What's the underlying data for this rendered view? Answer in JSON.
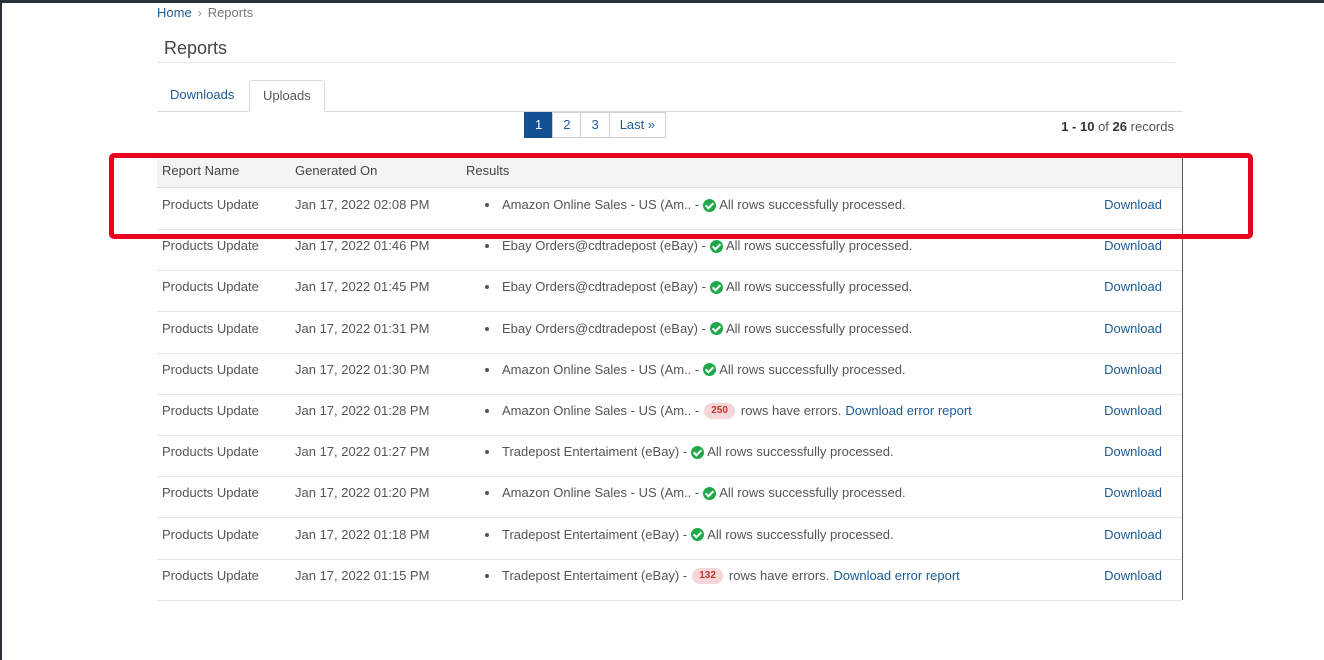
{
  "breadcrumb": {
    "home": "Home",
    "separator": "›",
    "current": "Reports"
  },
  "page": {
    "title": "Reports"
  },
  "tabs": [
    {
      "label": "Downloads"
    },
    {
      "label": "Uploads"
    }
  ],
  "pagination": {
    "pages": [
      "1",
      "2",
      "3"
    ],
    "last": "Last »",
    "active": "1"
  },
  "records": {
    "range": "1 - 10",
    "of": "of",
    "total": "26",
    "suffix": "records"
  },
  "table": {
    "headers": {
      "name": "Report Name",
      "date": "Generated On",
      "results": "Results"
    },
    "rows": [
      {
        "name": "Products Update",
        "date": "Jan 17, 2022 02:08 PM",
        "source": "Amazon Online Sales - US (Am.. -",
        "status": "ok",
        "message": "All rows successfully processed.",
        "download": "Download"
      },
      {
        "name": "Products Update",
        "date": "Jan 17, 2022 01:46 PM",
        "source": "Ebay Orders@cdtradepost (eBay) -",
        "status": "ok",
        "message": "All rows successfully processed.",
        "download": "Download"
      },
      {
        "name": "Products Update",
        "date": "Jan 17, 2022 01:45 PM",
        "source": "Ebay Orders@cdtradepost (eBay) -",
        "status": "ok",
        "message": "All rows successfully processed.",
        "download": "Download"
      },
      {
        "name": "Products Update",
        "date": "Jan 17, 2022 01:31 PM",
        "source": "Ebay Orders@cdtradepost (eBay) -",
        "status": "ok",
        "message": "All rows successfully processed.",
        "download": "Download"
      },
      {
        "name": "Products Update",
        "date": "Jan 17, 2022 01:30 PM",
        "source": "Amazon Online Sales - US (Am.. -",
        "status": "ok",
        "message": "All rows successfully processed.",
        "download": "Download"
      },
      {
        "name": "Products Update",
        "date": "Jan 17, 2022 01:28 PM",
        "source": "Amazon Online Sales - US (Am.. -",
        "status": "error",
        "error_count": "250",
        "message": "rows have errors.",
        "error_link": "Download error report",
        "download": "Download"
      },
      {
        "name": "Products Update",
        "date": "Jan 17, 2022 01:27 PM",
        "source": "Tradepost Entertaiment (eBay) -",
        "status": "ok",
        "message": "All rows successfully processed.",
        "download": "Download"
      },
      {
        "name": "Products Update",
        "date": "Jan 17, 2022 01:20 PM",
        "source": "Amazon Online Sales - US (Am.. -",
        "status": "ok",
        "message": "All rows successfully processed.",
        "download": "Download"
      },
      {
        "name": "Products Update",
        "date": "Jan 17, 2022 01:18 PM",
        "source": "Tradepost Entertaiment (eBay) -",
        "status": "ok",
        "message": "All rows successfully processed.",
        "download": "Download"
      },
      {
        "name": "Products Update",
        "date": "Jan 17, 2022 01:15 PM",
        "source": "Tradepost Entertaiment (eBay) -",
        "status": "error",
        "error_count": "132",
        "message": "rows have errors.",
        "error_link": "Download error report",
        "download": "Download"
      }
    ]
  },
  "colors": {
    "link": "#1a5c99",
    "active_page": "#134f93",
    "success": "#1fa84a",
    "error_badge_bg": "#f4d6d8",
    "highlight": "#e8001c"
  },
  "icons": {
    "success": "check-circle-icon",
    "separator": "chevron-right-icon"
  }
}
